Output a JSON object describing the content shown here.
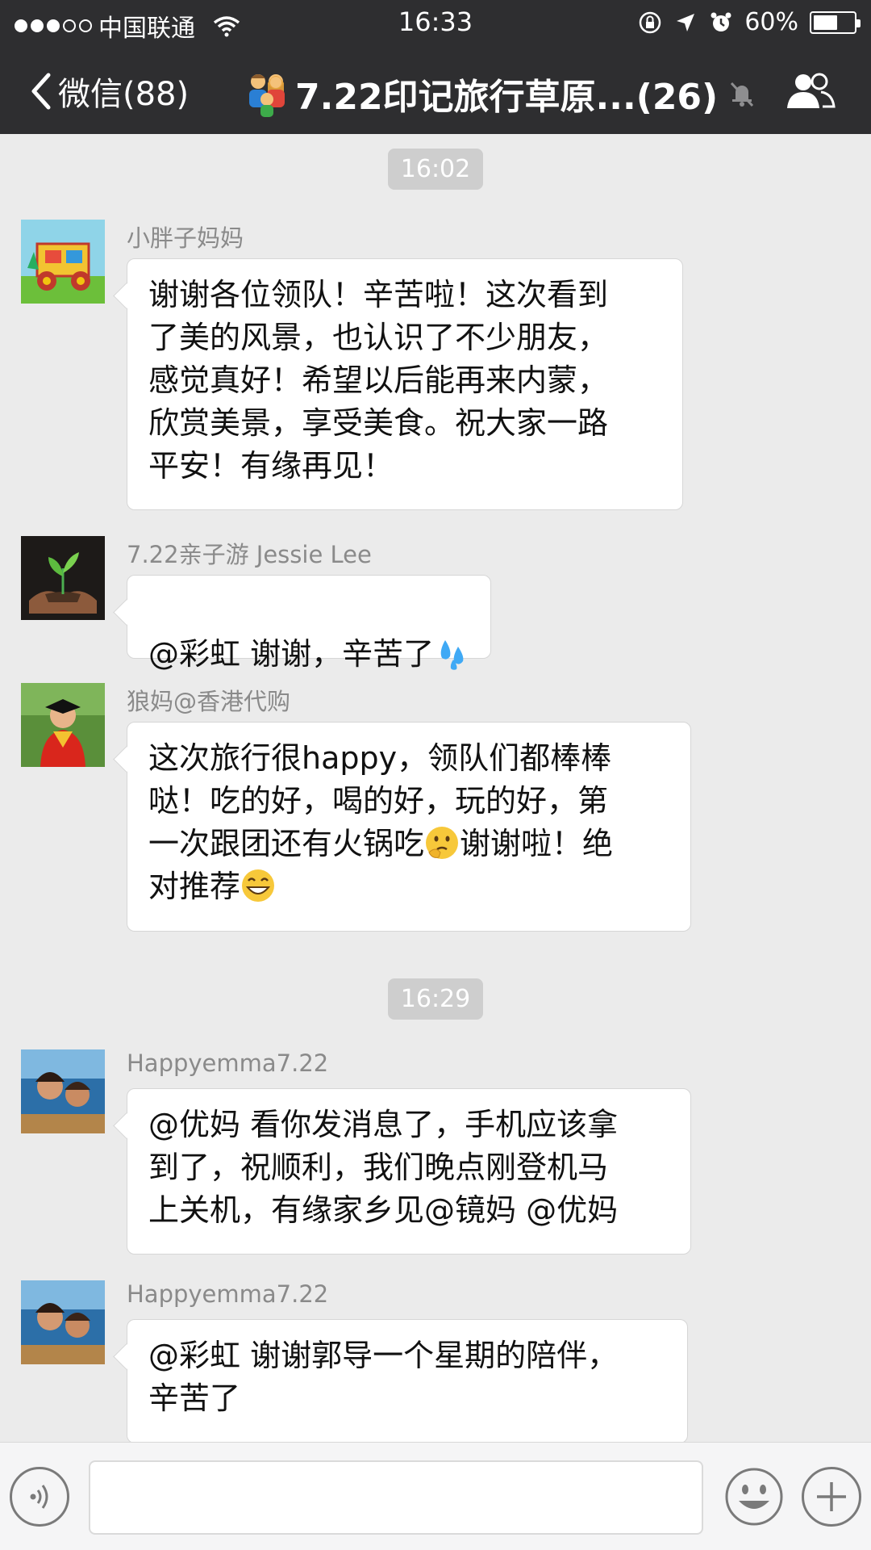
{
  "status_bar": {
    "carrier": "中国联通",
    "time": "16:33",
    "battery": "60%",
    "battery_level": 0.6,
    "signal_bars_filled": 3,
    "signal_bars_total": 5
  },
  "nav": {
    "back_label": "微信(88)",
    "title": "7.22印记旅行草原...(26)"
  },
  "chat": {
    "timestamps": [
      "16:02",
      "16:29"
    ],
    "messages": [
      {
        "sender": "小胖子妈妈",
        "text": "谢谢各位领队！辛苦啦！这次看到\n了美的风景，也认识了不少朋友，\n感觉真好！希望以后能再来内蒙，\n欣赏美景，享受美食。祝大家一路\n平安！有缘再见！"
      },
      {
        "sender": "7.22亲子游 Jessie  Lee",
        "text": "@彩虹 谢谢，辛苦了"
      },
      {
        "sender": "狼妈@香港代购",
        "text_1": "这次旅行很happy，领队们都棒棒\n哒！吃的好，喝的好，玩的好，第\n一次跟团还有火锅吃",
        "text_2": "谢谢啦！绝\n对推荐"
      },
      {
        "sender": "Happyemma7.22",
        "text": "@优妈 看你发消息了，手机应该拿\n到了，祝顺利，我们晚点刚登机马\n上关机，有缘家乡见@镜妈 @优妈"
      },
      {
        "sender": "Happyemma7.22",
        "text": "@彩虹 谢谢郭导一个星期的陪伴，\n辛苦了"
      }
    ]
  },
  "input": {
    "value": ""
  },
  "colors": {
    "bar_bg": "#2e2e30",
    "chat_bg": "#ebebeb",
    "bubble_bg": "#ffffff",
    "sender_text": "#8a8a8a",
    "timestamp_bg": "#cecece"
  }
}
